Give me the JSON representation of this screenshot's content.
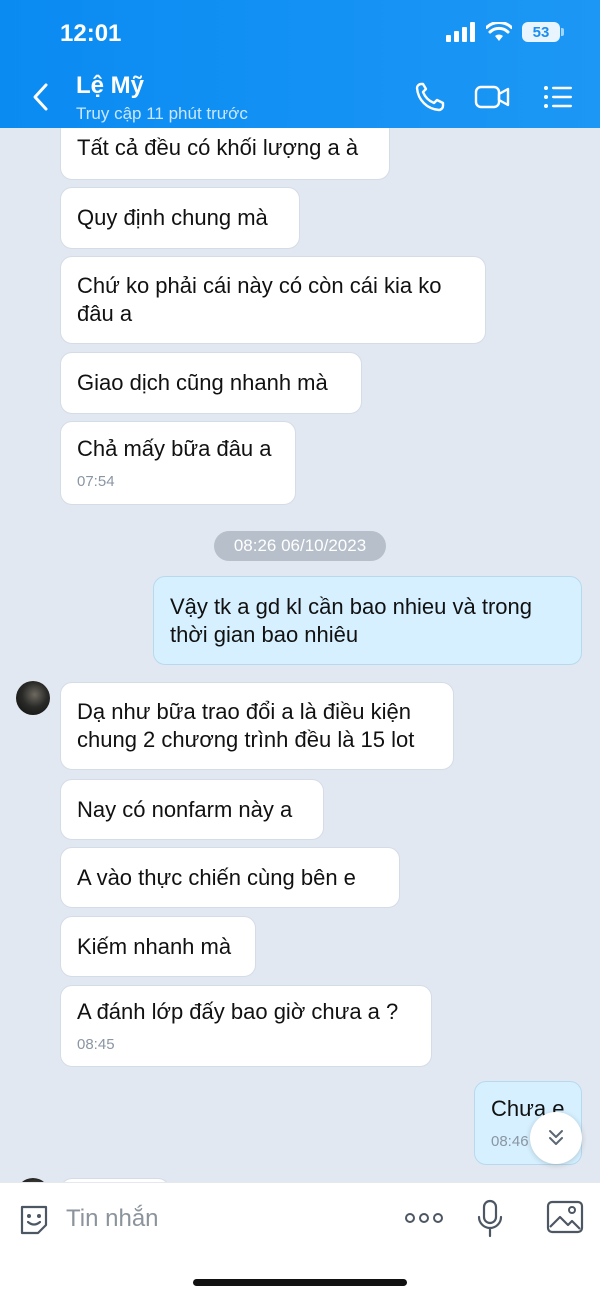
{
  "status_bar": {
    "time": "12:01",
    "battery": "53"
  },
  "header": {
    "contact_name": "Lệ Mỹ",
    "last_seen": "Truy cập 11 phút trước",
    "icons": [
      "back-icon",
      "phone-icon",
      "video-call-icon",
      "menu-icon"
    ]
  },
  "messages": [
    {
      "id": "m0",
      "from": "contact",
      "text": "Tất cả đều có khối lượng a à"
    },
    {
      "id": "m1",
      "from": "contact",
      "text": "Quy định chung mà"
    },
    {
      "id": "m2",
      "from": "contact",
      "text": "Chứ ko phải cái này có còn cái kia ko đâu a"
    },
    {
      "id": "m3",
      "from": "contact",
      "text": "Giao dịch cũng nhanh mà"
    },
    {
      "id": "m4",
      "from": "contact",
      "text": "Chả mấy bữa đâu a",
      "time": "07:54"
    },
    {
      "id": "m5",
      "from": "me",
      "text": "Vậy tk a gd kl cần bao nhieu và trong thời gian bao nhiêu"
    },
    {
      "id": "m6",
      "from": "contact",
      "text": "Dạ như bữa trao đổi a là điều kiện chung 2 chương trình đều là 15 lot"
    },
    {
      "id": "m7",
      "from": "contact",
      "text": "Nay có nonfarm này a"
    },
    {
      "id": "m8",
      "from": "contact",
      "text": "A vào thực chiến cùng bên e"
    },
    {
      "id": "m9",
      "from": "contact",
      "text": "Kiếm nhanh mà"
    },
    {
      "id": "m10",
      "from": "contact",
      "text": "A đánh lớp đấy bao giờ chưa a ?",
      "time": "08:45"
    },
    {
      "id": "m11",
      "from": "me",
      "text": "Chưa e",
      "time": "08:46"
    }
  ],
  "date_separator": "08:26 06/10/2023",
  "composer": {
    "placeholder": "Tin nhắn",
    "icons": [
      "sticker-icon",
      "more-icon",
      "microphone-icon",
      "image-icon"
    ]
  },
  "colors": {
    "header": "#0a8bf2",
    "background": "#e2e8f1",
    "sent_bubble": "#d6f0ff",
    "received_bubble": "#ffffff"
  }
}
